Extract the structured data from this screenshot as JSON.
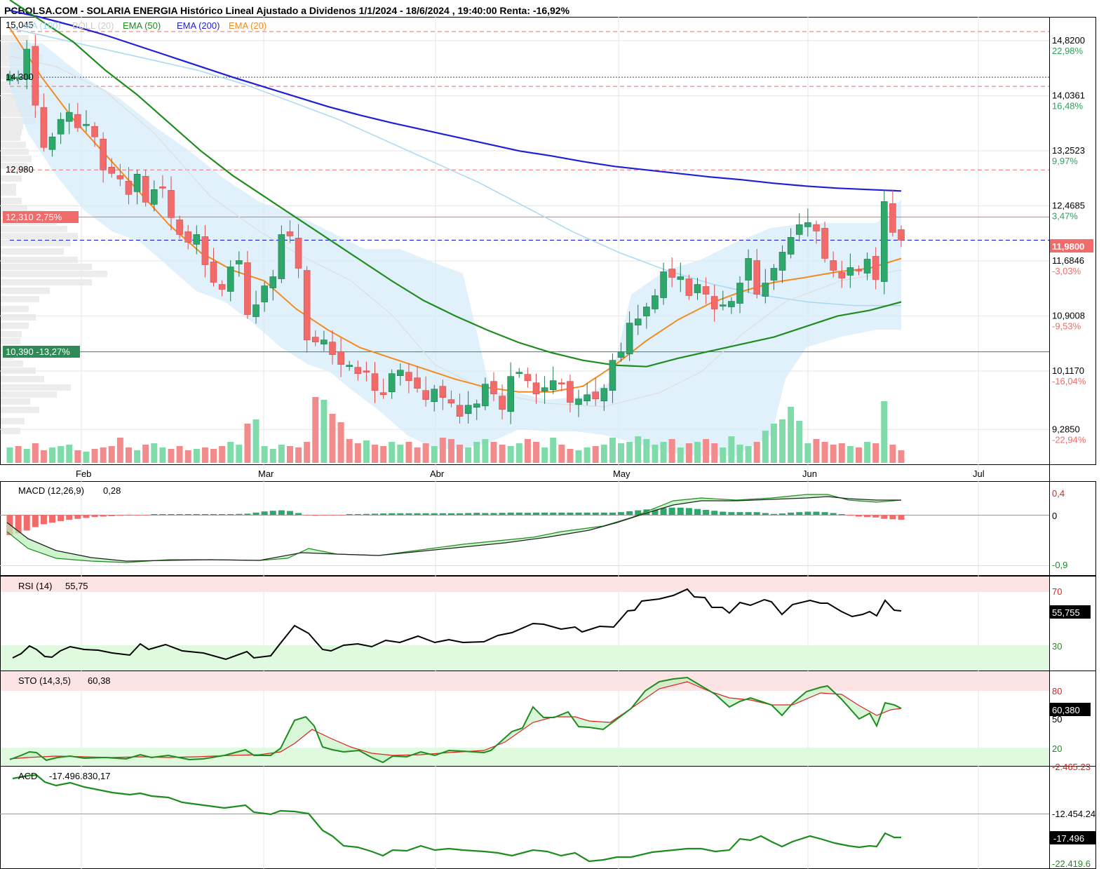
{
  "header": {
    "title": "PCBOLSA.COM - SOLARIA ENERGIA Histórico Lineal Ajustado a Dividenos 1/1/2024 - 18/6/2024 , 19:40:00 Renta: -16,92%"
  },
  "colors": {
    "up": "#26a269",
    "up_fill": "#2ea86a",
    "down": "#f26b6b",
    "vol_up": "#7fdcaa",
    "vol_down": "#f28b8b",
    "ema200": "#1f1fd6",
    "ema50": "#1e8c1e",
    "ema20": "#f58a1f",
    "ma100": "#a9d8f2",
    "boll_fill": "#d6ecfa",
    "support": "#2e8b57",
    "resistance": "#f26b6b",
    "current": "#1f1fd6"
  },
  "legend": {
    "price_start": "15,045",
    "items": [
      {
        "label": "MA (100)",
        "color": "#a9d8f2"
      },
      {
        "label": "BOLL (20)",
        "color": "#cccccc"
      },
      {
        "label": "EMA (50)",
        "color": "#1e8c1e"
      },
      {
        "label": "EMA (200)",
        "color": "#1f1fd6"
      },
      {
        "label": "EMA (20)",
        "color": "#f58a1f"
      }
    ]
  },
  "price_labels": {
    "left": [
      {
        "text": "14,300",
        "value": 14.3
      },
      {
        "text": "12,980",
        "value": 12.98
      }
    ],
    "resistance_tag": "12,310  2,75%",
    "support_tag": "10,390  -13,27%",
    "current_tag": "11,9800"
  },
  "right_axis": [
    {
      "value": 14.82,
      "price": "14,8200",
      "pct": "22,98%",
      "pos": true
    },
    {
      "value": 14.0361,
      "price": "14,0361",
      "pct": "16,48%",
      "pos": true
    },
    {
      "value": 13.2523,
      "price": "13,2523",
      "pct": "9,97%",
      "pos": true
    },
    {
      "value": 12.4685,
      "price": "12,4685",
      "pct": "3,47%",
      "pos": true
    },
    {
      "value": 11.6846,
      "price": "11,6846",
      "pct": "-3,03%",
      "pos": false
    },
    {
      "value": 10.9008,
      "price": "10,9008",
      "pct": "-9,53%",
      "pos": false
    },
    {
      "value": 10.117,
      "price": "10,1170",
      "pct": "-16,04%",
      "pos": false
    },
    {
      "value": 9.285,
      "price": "9,2850",
      "pct": "-22,94%",
      "pos": false
    }
  ],
  "months": [
    "Feb",
    "Mar",
    "Abr",
    "May",
    "Jun",
    "Jul"
  ],
  "indicators": {
    "macd": {
      "label": "MACD (12,26,9)",
      "value": "0,28",
      "ticks": [
        "0,4",
        "0",
        "-0,9"
      ]
    },
    "rsi": {
      "label": "RSI (14)",
      "value": "55,75",
      "ticks": [
        "70",
        "30"
      ],
      "current_tag": "55,755"
    },
    "sto": {
      "label": "STO (14,3,5)",
      "value": "60,38",
      "ticks": [
        "80",
        "50",
        "20"
      ],
      "current_tag": "60,380"
    },
    "acd": {
      "label": "ACD",
      "value": "-17.496.830,17",
      "ticks": [
        "-2.465.23",
        "-12.454.24",
        "-22.419.6"
      ],
      "current_tag": "-17.496"
    }
  },
  "chart_data": {
    "type": "candlestick",
    "title": "SOLARIA ENERGIA Histórico Lineal Ajustado a Dividenos 1/1/2024 - 18/6/2024",
    "ylim": [
      9.1,
      15.1
    ],
    "support_level": 10.39,
    "resistance_level": 12.31,
    "current_price": 11.98,
    "dashed_levels": [
      14.95,
      14.17,
      12.98
    ],
    "dotted_level": 14.3,
    "candles_close": [
      14.33,
      14.3,
      14.7,
      13.9,
      13.3,
      13.45,
      13.7,
      13.8,
      13.58,
      13.63,
      13.45,
      12.98,
      12.93,
      12.85,
      12.63,
      12.92,
      12.52,
      12.7,
      12.72,
      12.3,
      12.06,
      11.95,
      12.06,
      11.63,
      11.38,
      11.28,
      11.6,
      11.69,
      10.92,
      11.06,
      11.33,
      11.46,
      12.06,
      12.04,
      11.58,
      10.56,
      10.53,
      10.56,
      10.35,
      10.21,
      10.2,
      10.08,
      10.11,
      9.84,
      9.78,
      10.08,
      10.13,
      9.98,
      9.87,
      9.71,
      9.86,
      9.74,
      9.66,
      9.47,
      9.63,
      9.65,
      9.93,
      9.79,
      9.57,
      10.04,
      10.1,
      9.98,
      9.79,
      9.88,
      9.98,
      9.93,
      9.67,
      9.72,
      9.78,
      9.72,
      9.87,
      10.27,
      10.39,
      10.8,
      10.86,
      11.03,
      11.19,
      11.53,
      11.45,
      11.46,
      11.19,
      11.35,
      11.21,
      11.0,
      11.06,
      11.11,
      11.37,
      11.72,
      11.21,
      11.37,
      11.58,
      11.81,
      12.02,
      12.2,
      12.23,
      12.11,
      11.72,
      11.55,
      11.44,
      11.59,
      11.54,
      11.71,
      11.42,
      12.53,
      12.09,
      11.98
    ],
    "series": [
      {
        "name": "EMA (200)",
        "values": [
          15.25,
          15.15,
          15.03,
          14.9,
          14.75,
          14.6,
          14.45,
          14.3,
          14.16,
          14.02,
          13.88,
          13.76,
          13.65,
          13.55,
          13.45,
          13.35,
          13.25,
          13.18,
          13.1,
          13.03,
          12.98,
          12.93,
          12.88,
          12.84,
          12.79,
          12.75,
          12.72,
          12.7,
          12.68
        ]
      },
      {
        "name": "EMA (50)",
        "values": [
          15.4,
          15.1,
          14.8,
          14.4,
          14.05,
          13.65,
          13.25,
          12.9,
          12.6,
          12.3,
          12.0,
          11.7,
          11.4,
          11.12,
          10.9,
          10.7,
          10.52,
          10.38,
          10.27,
          10.2,
          10.18,
          10.3,
          10.4,
          10.5,
          10.6,
          10.75,
          10.9,
          10.98,
          11.1
        ]
      },
      {
        "name": "EMA (20)",
        "values": [
          15.0,
          14.3,
          13.7,
          13.2,
          12.7,
          12.2,
          11.8,
          11.55,
          11.4,
          11.0,
          10.7,
          10.45,
          10.3,
          10.15,
          10.0,
          9.88,
          9.82,
          9.82,
          9.9,
          10.2,
          10.55,
          10.85,
          11.08,
          11.25,
          11.38,
          11.45,
          11.53,
          11.58,
          11.72
        ]
      },
      {
        "name": "MA (100)",
        "values": [
          15.0,
          14.85,
          14.7,
          14.55,
          14.4,
          14.2,
          13.95,
          13.7,
          13.4,
          13.1,
          12.8,
          12.45,
          12.1,
          11.8,
          11.55,
          11.35,
          11.2,
          11.1,
          11.05,
          11.05
        ]
      }
    ]
  }
}
